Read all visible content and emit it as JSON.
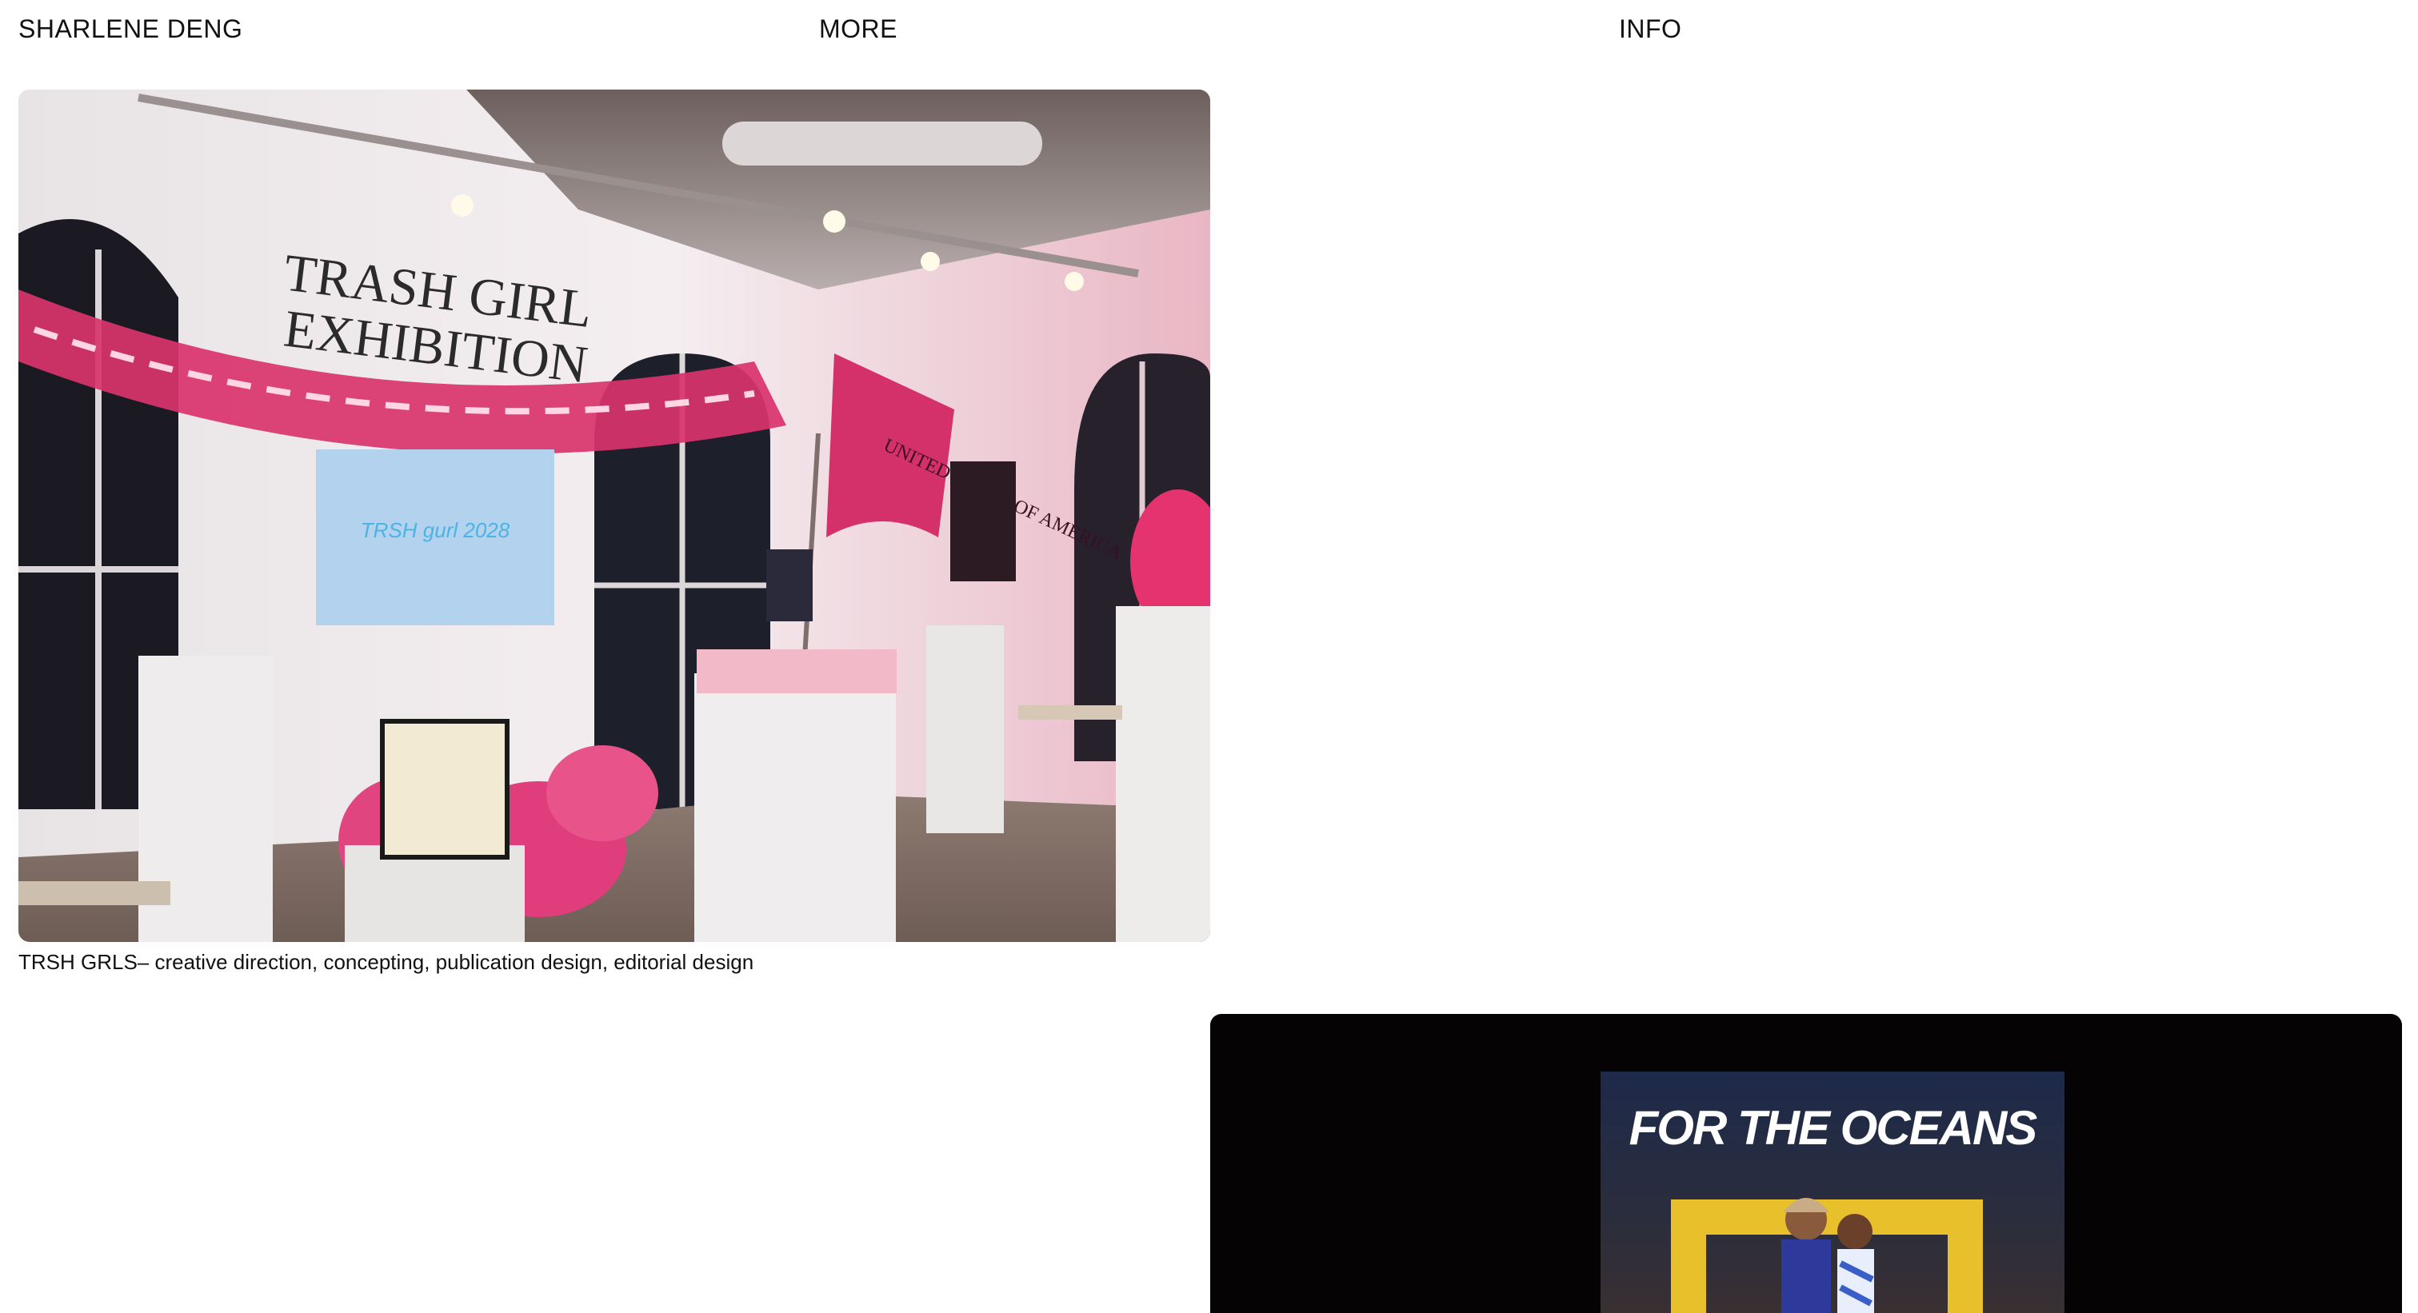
{
  "header": {
    "name": "SHARLENE DENG",
    "more": "MORE",
    "info": "INFO"
  },
  "projects": [
    {
      "caption": "TRSH GRLS– creative direction, concepting, publication design, editorial design",
      "wall_title_line1": "TRASH GIRL",
      "wall_title_line2": "EXHIBITION",
      "screen_text": "TRSH gurl 2028",
      "flag_text": "UNITED TRASH OF AMERICA"
    },
    {
      "cover_title": "FOR THE OCEANS"
    }
  ],
  "colors": {
    "background": "#ffffff",
    "text": "#111111",
    "accent_pink": "#d9336b",
    "frame_yellow": "#e7c02b"
  }
}
